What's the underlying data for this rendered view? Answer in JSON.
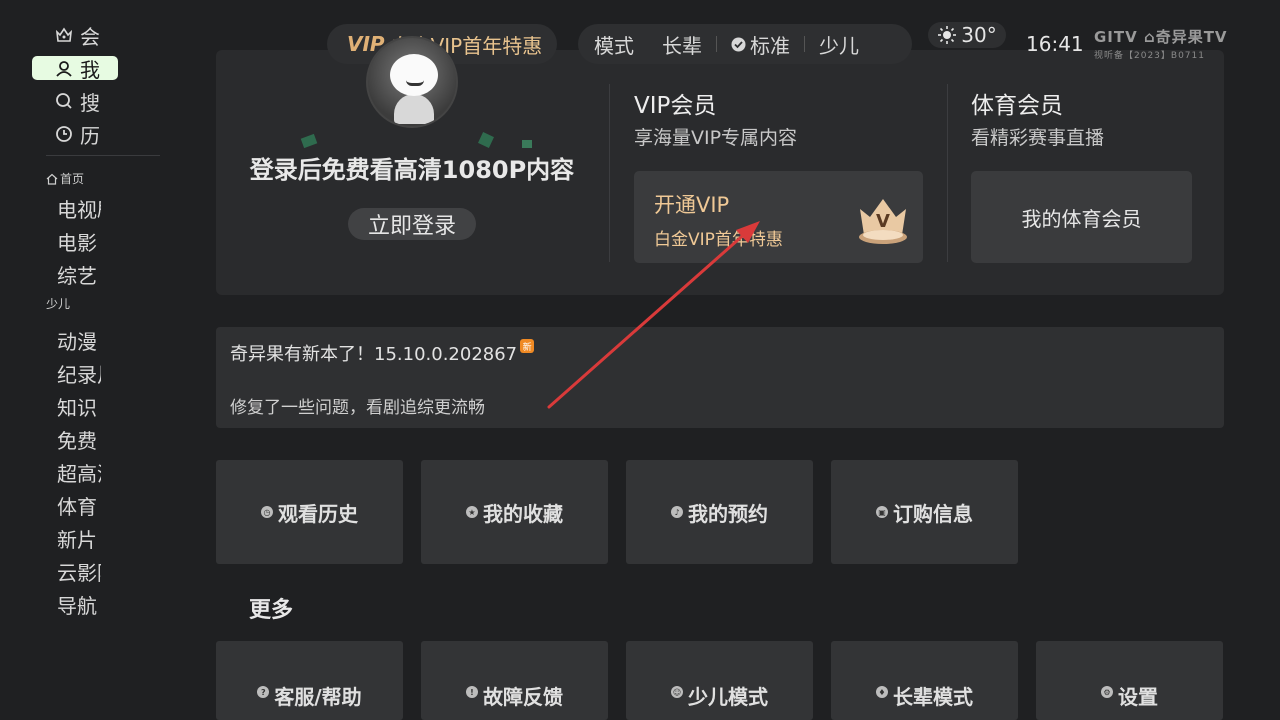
{
  "sidebar": {
    "top_items": [
      {
        "label": "会",
        "icon": "member-icon"
      },
      {
        "label": "我",
        "icon": "profile-icon"
      },
      {
        "label": "搜",
        "icon": "search-icon"
      },
      {
        "label": "历",
        "icon": "history-icon"
      }
    ],
    "groups": [
      {
        "label": "首页",
        "icon": "home-icon"
      },
      {
        "label": "少儿"
      }
    ],
    "channels_a": [
      "电视剧",
      "电影",
      "综艺"
    ],
    "channels_b": [
      "动漫",
      "纪录片",
      "知识",
      "免费",
      "超高清",
      "体育",
      "新片",
      "云影院",
      "导航"
    ]
  },
  "topbar": {
    "vip_tag": "VIP",
    "vip_promo": "白金VIP首年特惠",
    "modes": [
      "模式",
      "长辈",
      "标准",
      "少儿"
    ],
    "weather_temp": "30°",
    "time": "16:41",
    "brand_logo": "GITV ⌂奇异果TV",
    "brand_license": "视听备【2023】B0711"
  },
  "account": {
    "login_prompt": "登录后免费看高清1080P内容",
    "login_button": "立即登录"
  },
  "vip_section": {
    "title": "VIP会员",
    "subtitle": "享海量VIP专属内容",
    "open_label": "开通VIP",
    "open_promo": "白金VIP首年特惠",
    "crown_letter": "V"
  },
  "sports_section": {
    "title": "体育会员",
    "subtitle": "看精彩赛事直播",
    "button": "我的体育会员"
  },
  "update_notice": {
    "title": "奇异果有新本了！15.10.0.202867",
    "badge": "新",
    "detail": "修复了一些问题，看剧追综更流畅"
  },
  "quick_tiles": [
    {
      "label": "观看历史",
      "icon_glyph": "◷"
    },
    {
      "label": "我的收藏",
      "icon_glyph": "★"
    },
    {
      "label": "我的预约",
      "icon_glyph": "♪"
    },
    {
      "label": "订购信息",
      "icon_glyph": "▣"
    }
  ],
  "more": {
    "title": "更多",
    "tiles": [
      {
        "label": "客服/帮助",
        "icon_glyph": "?"
      },
      {
        "label": "故障反馈",
        "icon_glyph": "!"
      },
      {
        "label": "少儿模式",
        "icon_glyph": "☺"
      },
      {
        "label": "长辈模式",
        "icon_glyph": "♦"
      },
      {
        "label": "设置",
        "icon_glyph": "⚙"
      }
    ]
  },
  "colors": {
    "background": "#1f2022",
    "card": "#2a2b2d",
    "vip_gold": "#f0c996",
    "active_nav": "#e7fbe2",
    "annotation_arrow": "#d93a3a"
  }
}
